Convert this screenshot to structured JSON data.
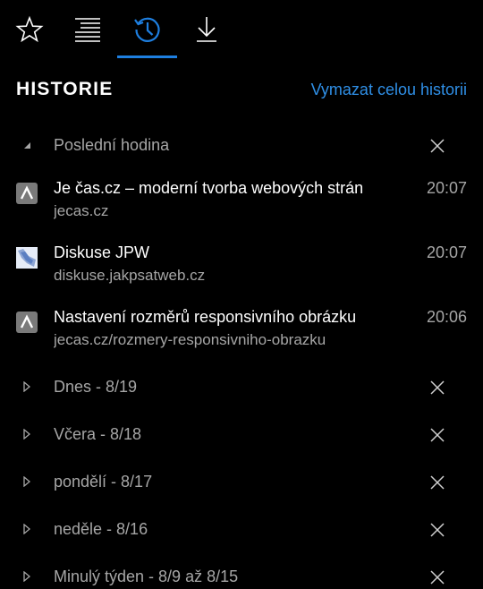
{
  "tabs": [
    {
      "name": "favorites",
      "icon": "star-icon"
    },
    {
      "name": "reading-list",
      "icon": "reading-list-icon"
    },
    {
      "name": "history",
      "icon": "history-clock-icon",
      "active": true
    },
    {
      "name": "downloads",
      "icon": "download-icon"
    }
  ],
  "accent_color": "#1e7fe0",
  "header": {
    "title": "HISTORIE",
    "clear_all": "Vymazat celou historii"
  },
  "groups": [
    {
      "label": "Poslední hodina",
      "expanded": true,
      "entries": [
        {
          "title": "Je čas.cz – moderní tvorba webových strán",
          "url": "jecas.cz",
          "time": "20:07",
          "icon": "jecas-favicon-icon"
        },
        {
          "title": "Diskuse JPW",
          "url": "diskuse.jakpsatweb.cz",
          "time": "20:07",
          "icon": "jpw-favicon-icon"
        },
        {
          "title": "Nastavení rozměrů responsivního obrázku",
          "url": "jecas.cz/rozmery-responsivniho-obrazku",
          "time": "20:06",
          "icon": "jecas-favicon-icon"
        }
      ]
    },
    {
      "label": "Dnes - 8/19",
      "expanded": false
    },
    {
      "label": "Včera - 8/18",
      "expanded": false
    },
    {
      "label": "pondělí - 8/17",
      "expanded": false
    },
    {
      "label": "neděle - 8/16",
      "expanded": false
    },
    {
      "label": "Minulý týden - 8/9 až 8/15",
      "expanded": false
    }
  ]
}
